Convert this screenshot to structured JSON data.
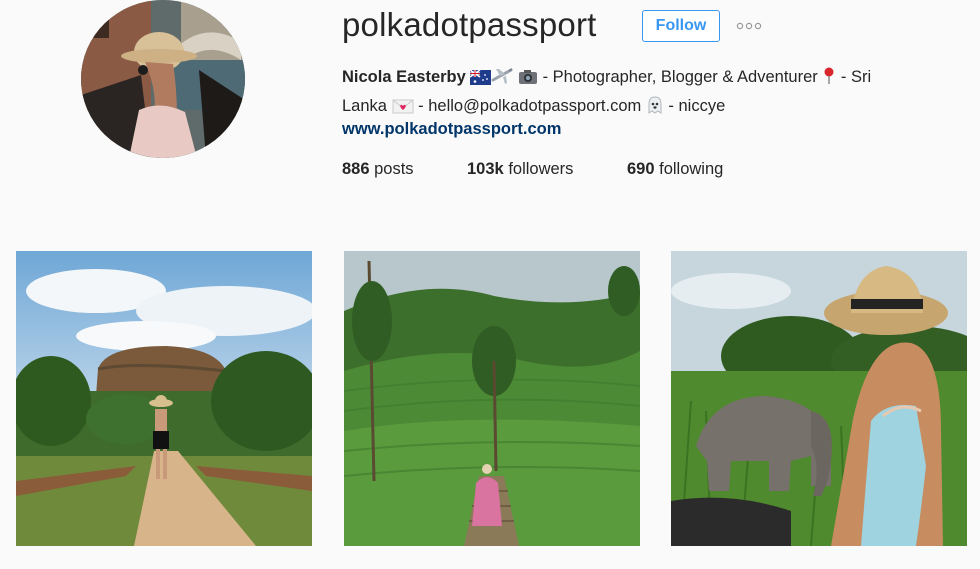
{
  "profile": {
    "username": "polkadotpassport",
    "follow_label": "Follow",
    "name": "Nicola Easterby",
    "bio_part1": " - Photographer, Blogger & Adventurer ",
    "bio_part2": " - Sri",
    "bio_line2_a": "Lanka ",
    "bio_line2_b": " - hello@polkadotpassport.com ",
    "bio_line2_c": " - niccye",
    "website": "www.polkadotpassport.com"
  },
  "stats": {
    "posts_count": "886",
    "posts_label": "posts",
    "followers_count": "103k",
    "followers_label": "followers",
    "following_count": "690",
    "following_label": "following"
  },
  "icons": [
    "australia-flag-icon",
    "airplane-icon",
    "camera-icon",
    "pin-icon",
    "love-letter-icon",
    "ghost-icon",
    "more-options-icon"
  ],
  "colors": {
    "accent": "#3897f0",
    "link": "#003569"
  }
}
